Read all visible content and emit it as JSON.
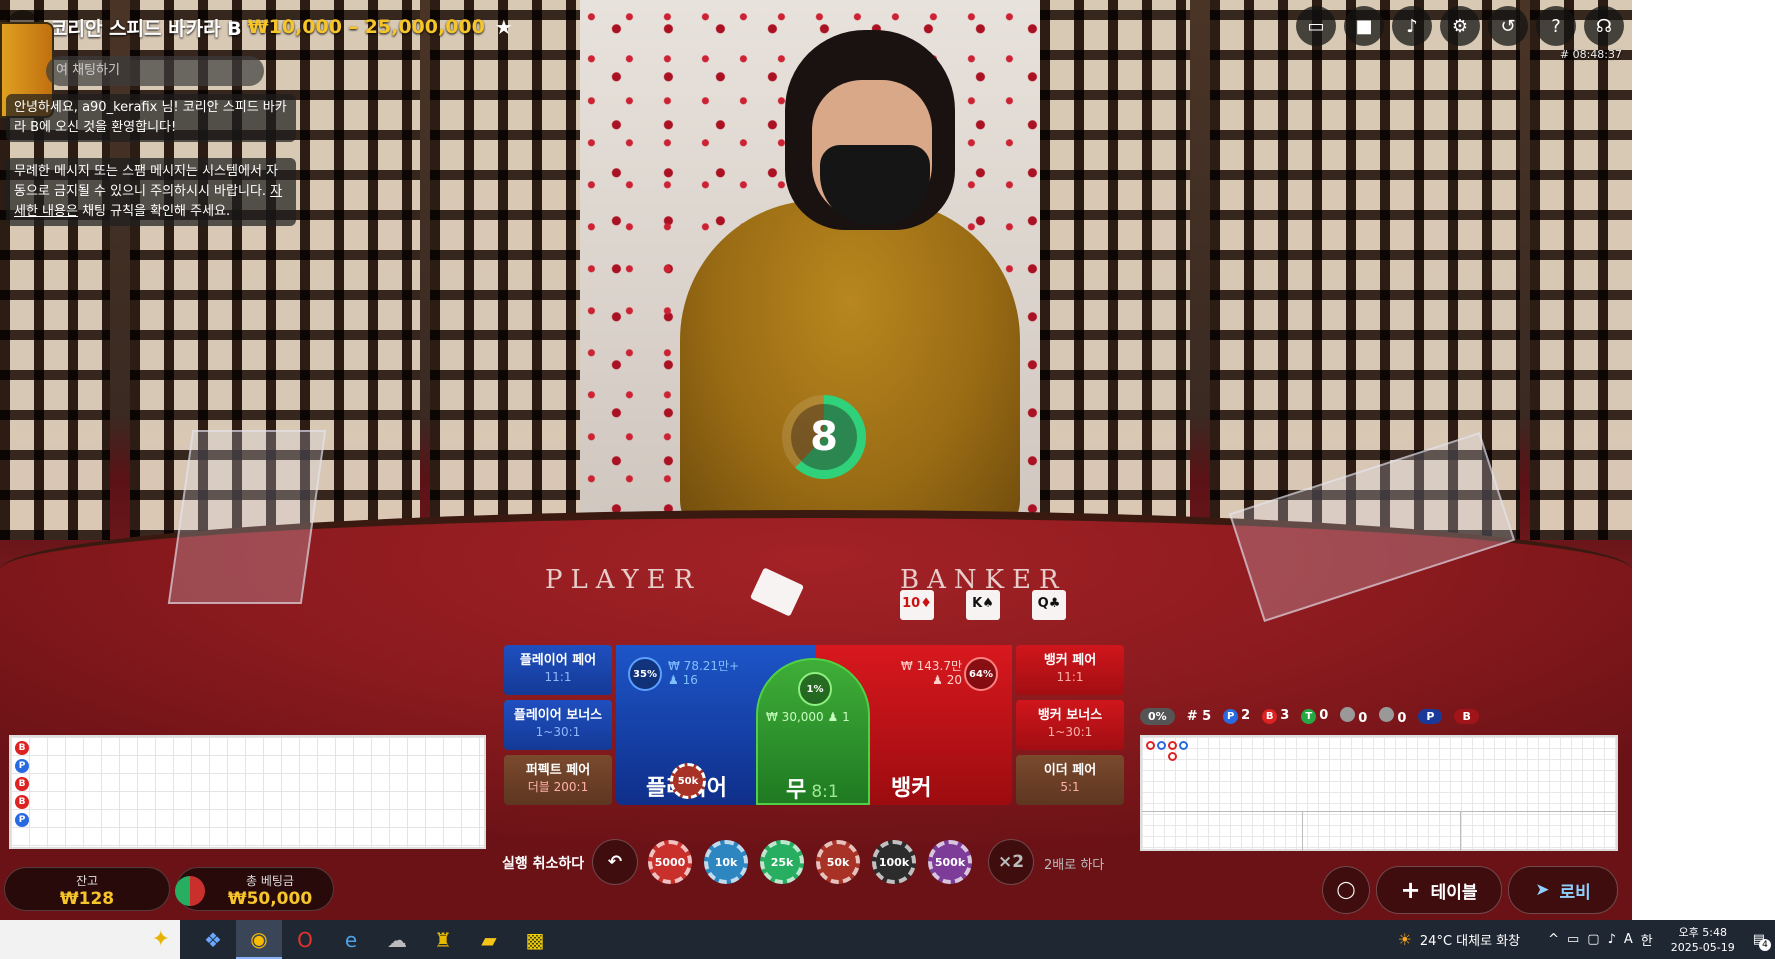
{
  "header": {
    "title": "코리안 스피드 바카라 B",
    "limits": "₩10,000 – 25,000,000",
    "round_id": "# 08:48:37",
    "icons": [
      "chat-icon",
      "video-icon",
      "volume-icon",
      "settings-icon",
      "history-icon",
      "help-icon",
      "headset-icon"
    ]
  },
  "chat": {
    "placeholder": "여 채팅하기",
    "welcome": "안녕하세요, a90_kerafix 님! 코리안 스피드 바카라 B에 오신 것을 환영합니다!",
    "warning_1": "무례한 메시지 또는 스팸 메시지는 시스템에서 자동으로 금지될 수 있으니 주의하시시 바랍니다. ",
    "warning_link": "자세한 내용은",
    "warning_2": " 채팅 규칙을 확인해 주세요."
  },
  "table_text": {
    "player": "PLAYER",
    "banker": "BANKER",
    "cards": [
      "10♦",
      "K♠",
      "Q♣"
    ]
  },
  "timer": {
    "value": "8",
    "fraction": 0.62
  },
  "side_bets": {
    "player_pair": {
      "label": "플레이어 페어",
      "odds": "11:1"
    },
    "player_bonus": {
      "label": "플레이어 보너스",
      "odds": "1~30:1"
    },
    "perfect_pair": {
      "label": "퍼펙트 페어",
      "odds": "더블 200:1"
    },
    "banker_pair": {
      "label": "뱅커 페어",
      "odds": "11:1"
    },
    "banker_bonus": {
      "label": "뱅커 보너스",
      "odds": "1~30:1"
    },
    "either_pair": {
      "label": "이더 페어",
      "odds": "5:1"
    }
  },
  "main_bets": {
    "player": {
      "label": "플레이어",
      "pct": "35%",
      "amount": "₩ 78.21만+",
      "players": "16",
      "chip": "50k"
    },
    "tie": {
      "label": "무",
      "odds": "8:1",
      "pct": "1%",
      "amount": "₩ 30,000",
      "players": "1"
    },
    "banker": {
      "label": "뱅커",
      "pct": "64%",
      "amount": "₩ 143.7만",
      "players": "20"
    }
  },
  "controls": {
    "undo_label": "실행 취소하다",
    "chips": [
      {
        "label": "5000",
        "color": "#c9302c"
      },
      {
        "label": "10k",
        "color": "#2e86c1"
      },
      {
        "label": "25k",
        "color": "#27ae60"
      },
      {
        "label": "50k",
        "color": "#a93226"
      },
      {
        "label": "100k",
        "color": "#2c2c2c"
      },
      {
        "label": "500k",
        "color": "#7d3c98"
      }
    ],
    "double_symbol": "×2",
    "double_label": "2배로 하다"
  },
  "balance": {
    "label": "잔고",
    "value": "₩128"
  },
  "total_bet": {
    "label": "총 베팅금",
    "value": "₩50,000"
  },
  "bead_road": [
    "B",
    "P",
    "B",
    "B",
    "P"
  ],
  "road_stats": {
    "shoe_pct": "0%",
    "rounds": "# 5",
    "p_count": "2",
    "b_count": "3",
    "t_count": "0",
    "pp_count": "0",
    "bp_count": "0",
    "p_predict": "P",
    "b_predict": "B"
  },
  "nav": {
    "tables": "테이블",
    "lobby": "로비"
  },
  "taskbar": {
    "weather": "24°C 대체로 화창",
    "time": "오후 5:48",
    "date": "2025-05-19",
    "notifications": "4"
  }
}
